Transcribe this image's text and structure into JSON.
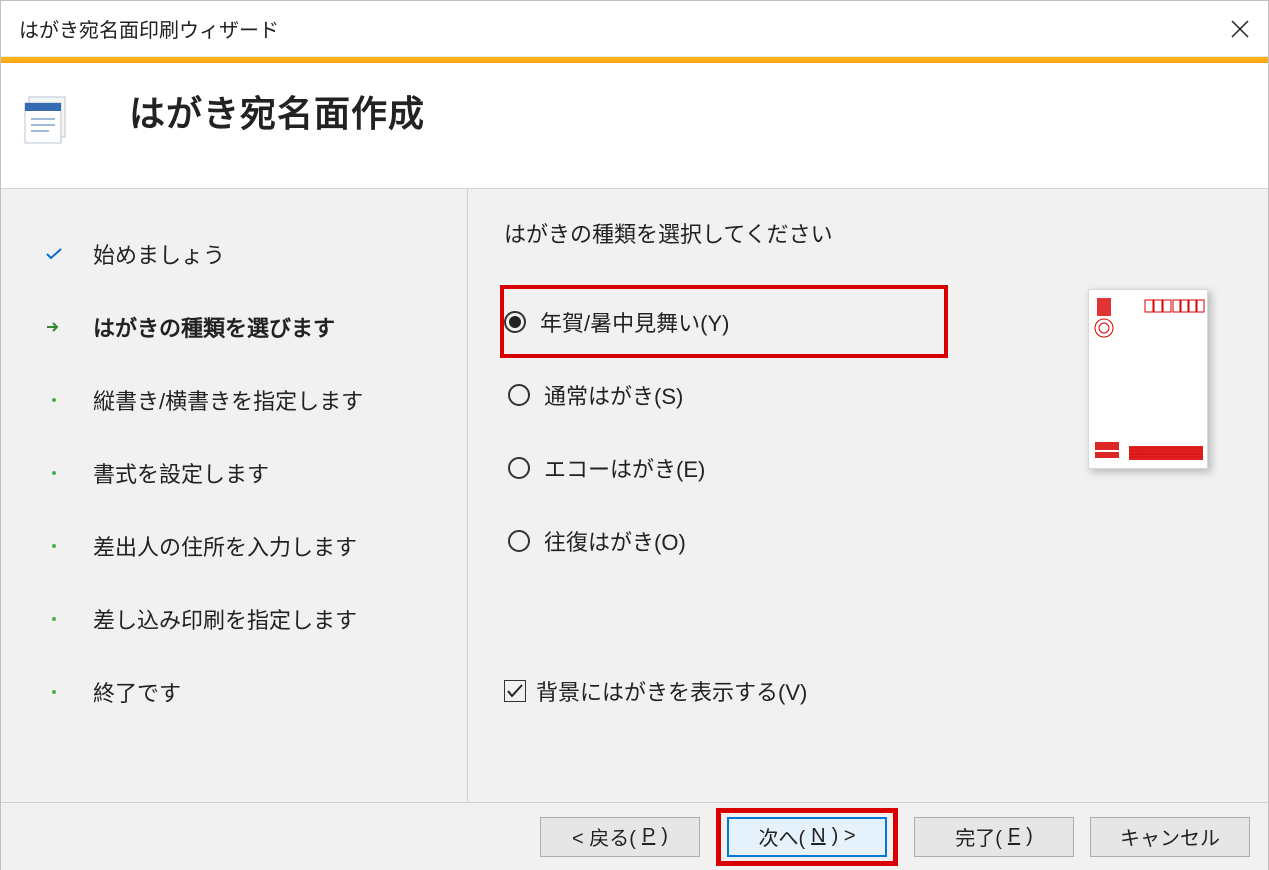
{
  "window": {
    "title": "はがき宛名面印刷ウィザード"
  },
  "header": {
    "title": "はがき宛名面作成"
  },
  "steps": [
    {
      "label": "始めましょう",
      "state": "done"
    },
    {
      "label": "はがきの種類を選びます",
      "state": "current"
    },
    {
      "label": "縦書き/横書きを指定します",
      "state": "pending"
    },
    {
      "label": "書式を設定します",
      "state": "pending"
    },
    {
      "label": "差出人の住所を入力します",
      "state": "pending"
    },
    {
      "label": "差し込み印刷を指定します",
      "state": "pending"
    },
    {
      "label": "終了です",
      "state": "pending"
    }
  ],
  "main": {
    "section_title": "はがきの種類を選択してください",
    "radios": [
      {
        "label": "年賀/暑中見舞い(Y)",
        "selected": true,
        "highlight": true
      },
      {
        "label": "通常はがき(S)",
        "selected": false,
        "highlight": false
      },
      {
        "label": "エコーはがき(E)",
        "selected": false,
        "highlight": false
      },
      {
        "label": "往復はがき(O)",
        "selected": false,
        "highlight": false
      }
    ],
    "checkbox": {
      "label": "背景にはがきを表示する(V)",
      "checked": true
    }
  },
  "footer": {
    "back_pre": "< 戻る(",
    "back_accel": "P",
    "back_post": ")",
    "next_pre": "次へ(",
    "next_accel": "N",
    "next_post": ") >",
    "finish_pre": "完了(",
    "finish_accel": "F",
    "finish_post": ")",
    "cancel": "キャンセル"
  },
  "colors": {
    "accent_orange": "#fdb813",
    "highlight_red": "#d80000",
    "focus_blue": "#0078d7"
  }
}
